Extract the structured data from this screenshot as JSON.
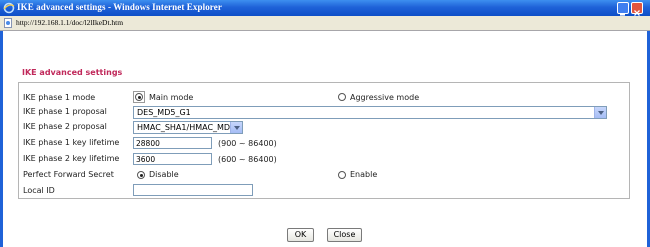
{
  "window": {
    "title": "IKE advanced settings - Windows Internet Explorer",
    "address": "http://192.168.1.1/doc/l2lIkeDt.htm",
    "accent": "#1f62d8"
  },
  "page": {
    "section_title": "IKE advanced settings",
    "title_color": "#c0285a"
  },
  "form": {
    "phase1_mode": {
      "label": "IKE phase 1 mode",
      "options": [
        "Main mode",
        "Aggressive mode"
      ],
      "selected": "Main mode"
    },
    "phase1_proposal": {
      "label": "IKE phase 1 proposal",
      "value": "DES_MD5_G1"
    },
    "phase2_proposal": {
      "label": "IKE phase 2 proposal",
      "value": "HMAC_SHA1/HMAC_MD5"
    },
    "phase1_lifetime": {
      "label": "IKE phase 1 key lifetime",
      "value": "28800",
      "hint": "(900 ~ 86400)"
    },
    "phase2_lifetime": {
      "label": "IKE phase 2 key lifetime",
      "value": "3600",
      "hint": "(600 ~ 86400)"
    },
    "pfs": {
      "label": "Perfect Forward Secret",
      "options": [
        "Disable",
        "Enable"
      ],
      "selected": "Disable"
    },
    "local_id": {
      "label": "Local ID",
      "value": ""
    }
  },
  "buttons": {
    "ok": "OK",
    "close": "Close"
  },
  "icons": [
    "ie-icon",
    "page-icon",
    "minimize-icon",
    "close-icon",
    "chevron-down-icon"
  ]
}
